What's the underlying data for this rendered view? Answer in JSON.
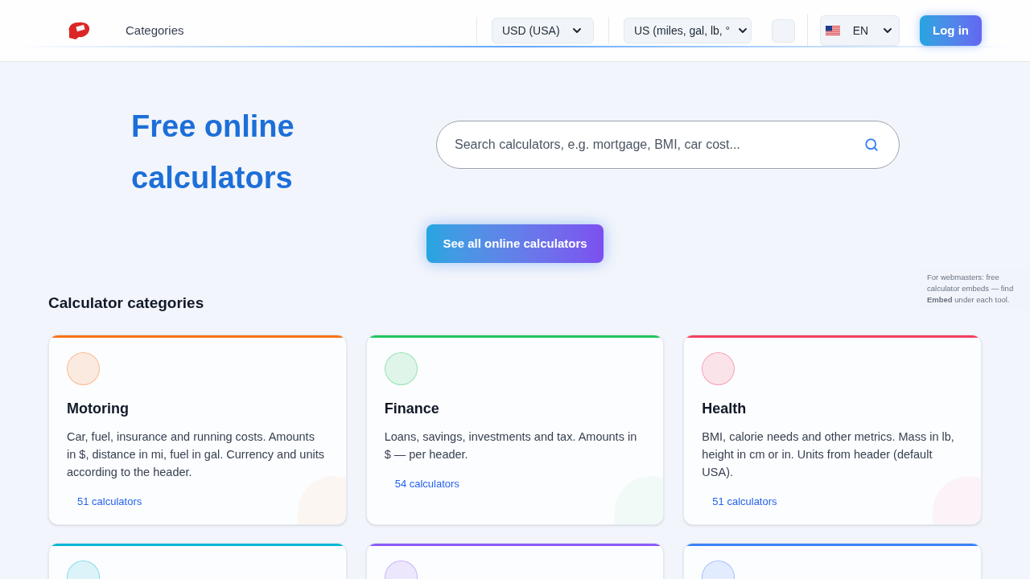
{
  "header": {
    "nav": [
      "Categories"
    ],
    "currency": "USD (USA)",
    "units": "US (miles, gal, lb, °",
    "language": "EN",
    "login": "Log in"
  },
  "hero": {
    "title_lines": [
      "Free online",
      "calculators"
    ],
    "search": {
      "placeholder": "Search calculators, e.g. mortgage, BMI, car cost..."
    },
    "cta": "See all online calculators"
  },
  "webmaster_note": "For webmasters: free calculator embeds — find **Embed** under each tool.",
  "categories": {
    "title": "Calculator categories",
    "cards": [
      {
        "name": "Motoring",
        "description": "Car, fuel, insurance and running costs. Amounts in $, distance in mi, fuel in gal. Currency and units according to the header.",
        "count": "51 calculators",
        "color": "#f97316"
      },
      {
        "name": "Finance",
        "description": "Loans, savings, investments and tax. Amounts in $ — per header.",
        "count": "54 calculators",
        "color": "#22c55e"
      },
      {
        "name": "Health",
        "description": "BMI, calorie needs and other metrics. Mass in lb, height in cm or in. Units from header (default USA).",
        "count": "51 calculators",
        "color": "#f43f5e"
      },
      {
        "color": "#06b6d4"
      },
      {
        "color": "#8b5cf6"
      },
      {
        "color": "#3b82f6"
      }
    ]
  }
}
